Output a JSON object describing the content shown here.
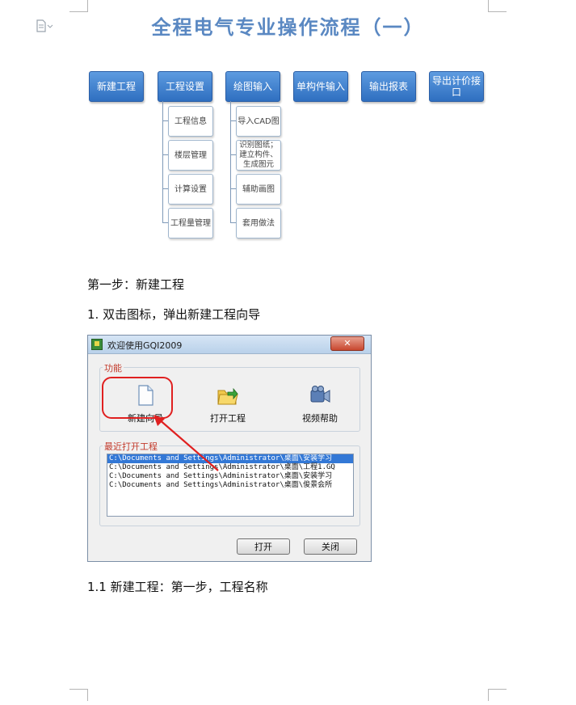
{
  "page": {
    "title": "全程电气专业操作流程（一）"
  },
  "flowchart": {
    "main_steps": [
      "新建工程",
      "工程设置",
      "绘图输入",
      "单构件输入",
      "输出报表",
      "导出计价接口"
    ],
    "project_settings_items": [
      "工程信息",
      "楼层管理",
      "计算设置",
      "工程量管理"
    ],
    "drawing_input_items": [
      "导入CAD图",
      "识别图纸；建立构件、生成图元",
      "辅助画图",
      "套用做法"
    ]
  },
  "body": {
    "step1_heading": "第一步：新建工程",
    "item1": "1. 双击图标，弹出新建工程向导",
    "item1_1": "1.1 新建工程：第一步，工程名称"
  },
  "dialog": {
    "title": "欢迎使用GQI2009",
    "close_label": "✕",
    "functions_label": "功能",
    "functions": [
      {
        "label": "新建向导",
        "icon": "new-document-icon"
      },
      {
        "label": "打开工程",
        "icon": "open-folder-icon"
      },
      {
        "label": "视频帮助",
        "icon": "video-camera-icon"
      }
    ],
    "recent_label": "最近打开工程",
    "recent_files": [
      "C:\\Documents and Settings\\Administrator\\桌面\\安装学习",
      "C:\\Documents and Settings\\Administrator\\桌面\\工程1.GQ",
      "C:\\Documents and Settings\\Administrator\\桌面\\安装学习",
      "C:\\Documents and Settings\\Administrator\\桌面\\俊景会所"
    ],
    "open_button": "打开",
    "close_button": "关闭"
  },
  "colors": {
    "title": "#5a88c2",
    "flow_box": "#2f6fc0",
    "annotation": "#e02020",
    "selection": "#3378d6"
  }
}
